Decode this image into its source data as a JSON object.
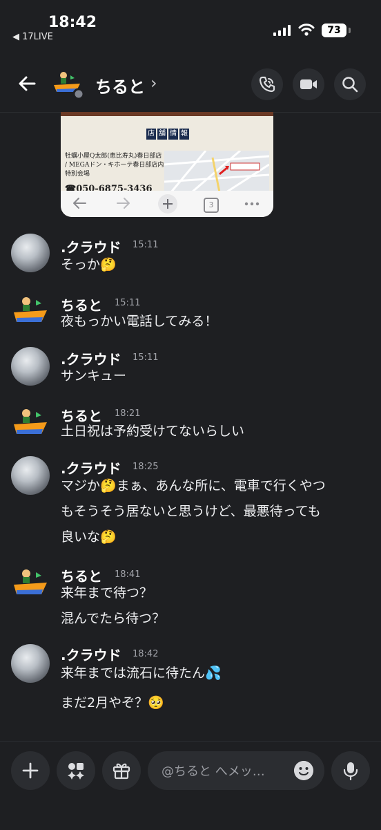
{
  "status": {
    "time": "18:42",
    "back_app": "◀ 17LIVE",
    "battery": "73"
  },
  "header": {
    "title": "ちると",
    "chevron": "›"
  },
  "embed": {
    "section_chars": [
      "店",
      "舗",
      "情",
      "報"
    ],
    "store_text": "牡蠣小屋Q太郎(恵比寿丸)春日部店 / MEGAドン・キホーテ春日部店内 特別会場",
    "phone": "☎050-6875-3436",
    "tab_count": "3"
  },
  "messages": [
    {
      "author": ".クラウド",
      "time": "15:11",
      "lines": [
        "そっか🤔"
      ]
    },
    {
      "author": "ちると",
      "time": "15:11",
      "lines": [
        "夜もっかい電話してみる！"
      ]
    },
    {
      "author": ".クラウド",
      "time": "15:11",
      "lines": [
        "サンキュー"
      ]
    },
    {
      "author": "ちると",
      "time": "18:21",
      "lines": [
        "土日祝は予約受けてないらしい"
      ]
    },
    {
      "author": ".クラウド",
      "time": "18:25",
      "lines": [
        "マジか🤔まぁ、あんな所に、電車で行くやつ",
        "もそうそう居ないと思うけど、最悪待っても",
        "良いな🤔"
      ]
    },
    {
      "author": "ちると",
      "time": "18:41",
      "lines": [
        "来年まで待つ？",
        "混んでたら待つ？"
      ]
    },
    {
      "author": ".クラウド",
      "time": "18:42",
      "lines": [
        "来年までは流石に待たん💦",
        "まだ2月やぞ？🥺"
      ]
    }
  ],
  "composer": {
    "placeholder": "@ちると へメッ…"
  },
  "colors": {
    "background": "#1e1f22",
    "surface": "#2b2d31",
    "muted": "#a0a2a8"
  }
}
